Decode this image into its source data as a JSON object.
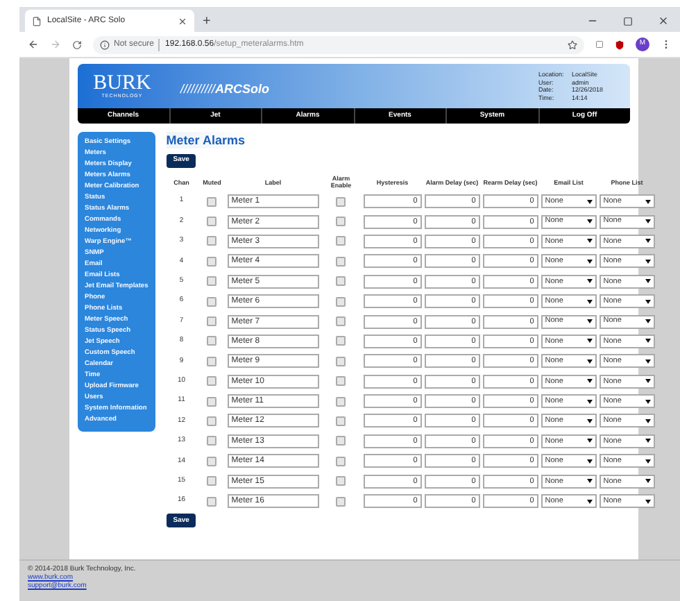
{
  "browser": {
    "tab_title": "LocalSite - ARC Solo",
    "new_tab": "+",
    "address_security": "Not secure",
    "address_host": "192.168.0.56",
    "address_path": "/setup_meteralarms.htm",
    "profile_initial": "M"
  },
  "header": {
    "logo_main": "BURK",
    "logo_sub": "TECHNOLOGY",
    "product_slashes": "//////////",
    "product_arc": "ARC",
    "product_solo": "Solo",
    "info": [
      {
        "label": "Location:",
        "value": "LocalSite"
      },
      {
        "label": "User:",
        "value": "admin"
      },
      {
        "label": "Date:",
        "value": "12/26/2018"
      },
      {
        "label": "Time:",
        "value": "14:14"
      }
    ]
  },
  "nav": [
    "Channels",
    "Jet",
    "Alarms",
    "Events",
    "System",
    "Log Off"
  ],
  "sidebar": {
    "items": [
      "Basic Settings",
      "Meters",
      "Meters Display",
      "Meters Alarms",
      "Meter Calibration",
      "Status",
      "Status Alarms",
      "Commands",
      "Networking",
      "Warp Engine™",
      "SNMP",
      "Email",
      "Email Lists",
      "Jet Email Templates",
      "Phone",
      "Phone Lists",
      "Meter Speech",
      "Status Speech",
      "Jet Speech",
      "Custom Speech",
      "Calendar",
      "Time",
      "Upload Firmware",
      "Users",
      "System Information",
      "Advanced"
    ]
  },
  "page_title": "Meter Alarms",
  "save_top": "Save",
  "table": {
    "columns": [
      "Chan",
      "Muted",
      "Label",
      "Alarm Enable",
      "Hysteresis",
      "Alarm Delay (sec)",
      "Rearm Delay (sec)",
      "Email List",
      "Phone List"
    ],
    "rows": [
      {
        "chan": "1",
        "muted": false,
        "label": "Meter 1",
        "enabled": false,
        "hysteresis": "0",
        "alarm_delay": "0",
        "rearm_delay": "0",
        "email_list": "None",
        "phone_list": "None"
      },
      {
        "chan": "2",
        "muted": false,
        "label": "Meter 2",
        "enabled": false,
        "hysteresis": "0",
        "alarm_delay": "0",
        "rearm_delay": "0",
        "email_list": "None",
        "phone_list": "None"
      },
      {
        "chan": "3",
        "muted": false,
        "label": "Meter 3",
        "enabled": false,
        "hysteresis": "0",
        "alarm_delay": "0",
        "rearm_delay": "0",
        "email_list": "None",
        "phone_list": "None"
      },
      {
        "chan": "4",
        "muted": false,
        "label": "Meter 4",
        "enabled": false,
        "hysteresis": "0",
        "alarm_delay": "0",
        "rearm_delay": "0",
        "email_list": "None",
        "phone_list": "None"
      },
      {
        "chan": "5",
        "muted": false,
        "label": "Meter 5",
        "enabled": false,
        "hysteresis": "0",
        "alarm_delay": "0",
        "rearm_delay": "0",
        "email_list": "None",
        "phone_list": "None"
      },
      {
        "chan": "6",
        "muted": false,
        "label": "Meter 6",
        "enabled": false,
        "hysteresis": "0",
        "alarm_delay": "0",
        "rearm_delay": "0",
        "email_list": "None",
        "phone_list": "None"
      },
      {
        "chan": "7",
        "muted": false,
        "label": "Meter 7",
        "enabled": false,
        "hysteresis": "0",
        "alarm_delay": "0",
        "rearm_delay": "0",
        "email_list": "None",
        "phone_list": "None"
      },
      {
        "chan": "8",
        "muted": false,
        "label": "Meter 8",
        "enabled": false,
        "hysteresis": "0",
        "alarm_delay": "0",
        "rearm_delay": "0",
        "email_list": "None",
        "phone_list": "None"
      },
      {
        "chan": "9",
        "muted": false,
        "label": "Meter 9",
        "enabled": false,
        "hysteresis": "0",
        "alarm_delay": "0",
        "rearm_delay": "0",
        "email_list": "None",
        "phone_list": "None"
      },
      {
        "chan": "10",
        "muted": false,
        "label": "Meter 10",
        "enabled": false,
        "hysteresis": "0",
        "alarm_delay": "0",
        "rearm_delay": "0",
        "email_list": "None",
        "phone_list": "None"
      },
      {
        "chan": "11",
        "muted": false,
        "label": "Meter 11",
        "enabled": false,
        "hysteresis": "0",
        "alarm_delay": "0",
        "rearm_delay": "0",
        "email_list": "None",
        "phone_list": "None"
      },
      {
        "chan": "12",
        "muted": false,
        "label": "Meter 12",
        "enabled": false,
        "hysteresis": "0",
        "alarm_delay": "0",
        "rearm_delay": "0",
        "email_list": "None",
        "phone_list": "None"
      },
      {
        "chan": "13",
        "muted": false,
        "label": "Meter 13",
        "enabled": false,
        "hysteresis": "0",
        "alarm_delay": "0",
        "rearm_delay": "0",
        "email_list": "None",
        "phone_list": "None"
      },
      {
        "chan": "14",
        "muted": false,
        "label": "Meter 14",
        "enabled": false,
        "hysteresis": "0",
        "alarm_delay": "0",
        "rearm_delay": "0",
        "email_list": "None",
        "phone_list": "None"
      },
      {
        "chan": "15",
        "muted": false,
        "label": "Meter 15",
        "enabled": false,
        "hysteresis": "0",
        "alarm_delay": "0",
        "rearm_delay": "0",
        "email_list": "None",
        "phone_list": "None"
      },
      {
        "chan": "16",
        "muted": false,
        "label": "Meter 16",
        "enabled": false,
        "hysteresis": "0",
        "alarm_delay": "0",
        "rearm_delay": "0",
        "email_list": "None",
        "phone_list": "None"
      }
    ]
  },
  "save_bottom": "Save",
  "footer": {
    "copyright": "© 2014-2018 Burk Technology, Inc.",
    "links": [
      "www.burk.com",
      "support@burk.com"
    ]
  }
}
